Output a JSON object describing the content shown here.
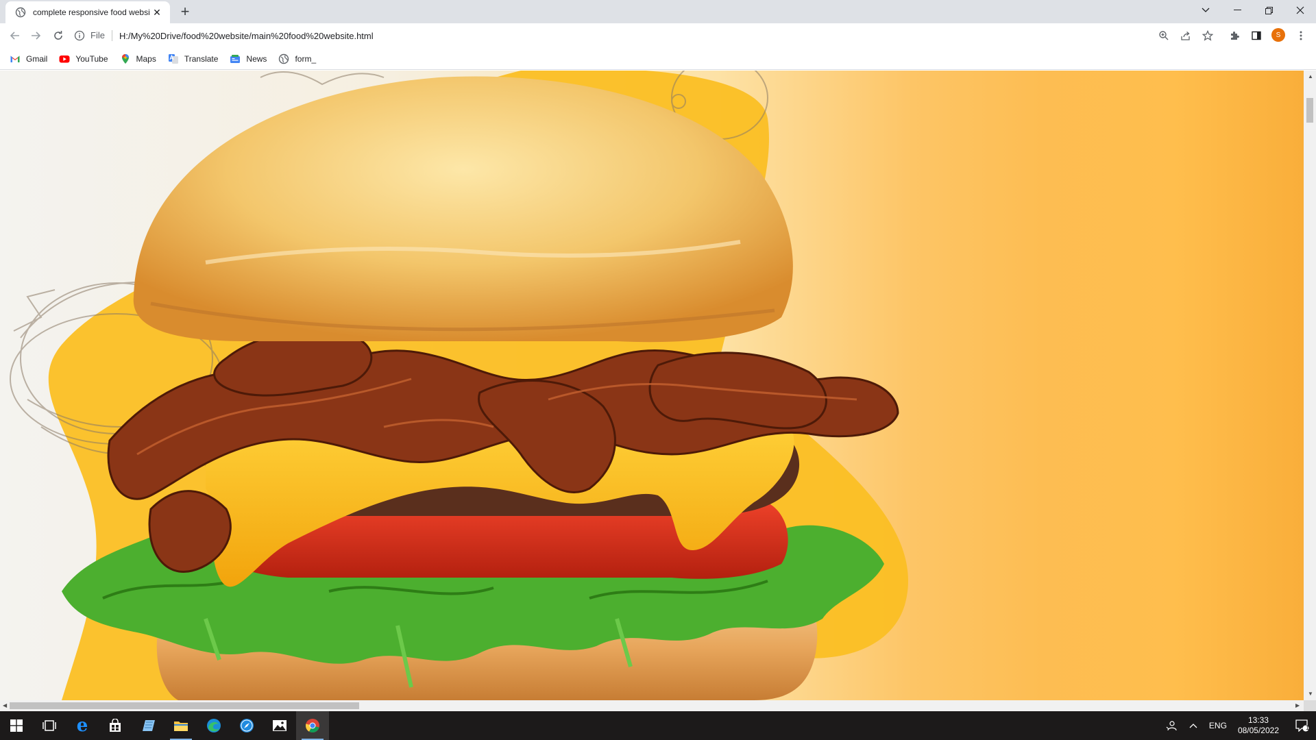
{
  "browser": {
    "tab_title": "complete responsive food website",
    "tab_title_display": "complete responsive food websi",
    "close_icon": "close-icon",
    "new_tab_icon": "plus-icon",
    "scheme_label": "File",
    "url": "H:/My%20Drive/food%20website/main%20food%20website.html",
    "profile_initial": "S",
    "accent_color": "#e8710a"
  },
  "bookmarks": [
    {
      "label": "Gmail",
      "icon": "gmail-icon"
    },
    {
      "label": "YouTube",
      "icon": "youtube-icon"
    },
    {
      "label": "Maps",
      "icon": "maps-icon"
    },
    {
      "label": "Translate",
      "icon": "translate-icon"
    },
    {
      "label": "News",
      "icon": "news-icon"
    },
    {
      "label": "form_",
      "icon": "globe-icon"
    }
  ],
  "page": {
    "hero_image": "burger-image",
    "colors": {
      "bg_light": "#f4f3ef",
      "bg_orange": "#fdbd52",
      "blob_yellow": "#fbbf24"
    }
  },
  "taskbar": {
    "apps": [
      "start-icon",
      "task-view-icon",
      "edge-legacy-icon",
      "store-icon",
      "notepad-icon",
      "file-explorer-icon",
      "edge-icon",
      "safari-icon",
      "photos-icon",
      "chrome-icon"
    ],
    "language": "ENG",
    "time": "13:33",
    "date": "08/05/2022",
    "notification_count": "1"
  }
}
